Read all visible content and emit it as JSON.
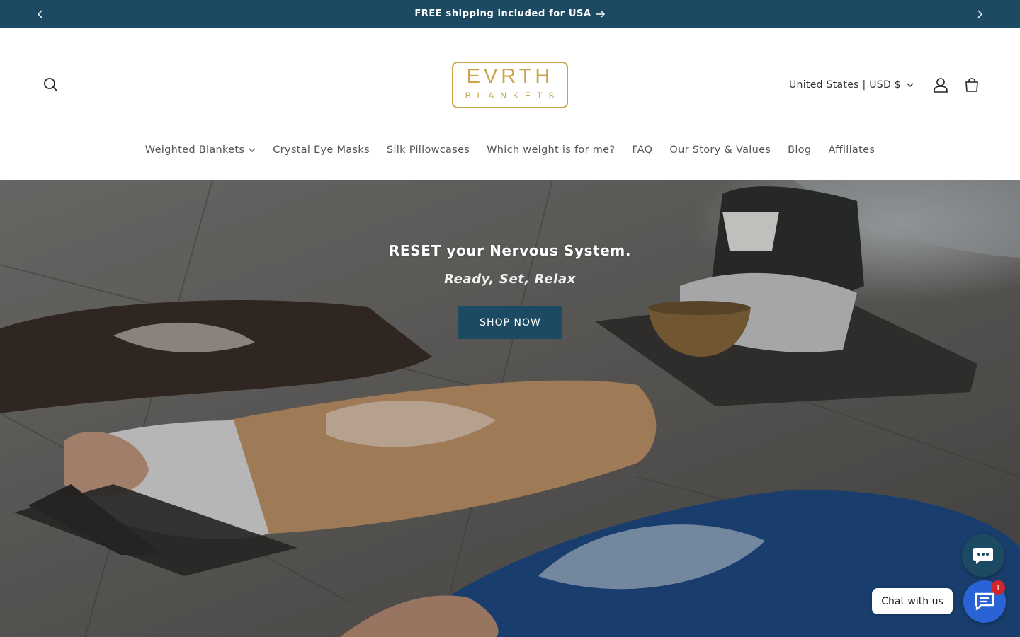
{
  "announcement": {
    "text": "FREE shipping included for USA",
    "prev_icon": "chevron-left-icon",
    "next_icon": "chevron-right-icon",
    "link_icon": "arrow-right-icon"
  },
  "header": {
    "logo": {
      "line1": "EVRTH",
      "line2": "BLANKETS",
      "color": "#c9a24a"
    },
    "locale": "United States | USD $",
    "icons": [
      "search-icon",
      "account-icon",
      "cart-icon"
    ]
  },
  "nav": {
    "items": [
      {
        "label": "Weighted Blankets",
        "has_dropdown": true
      },
      {
        "label": "Crystal Eye Masks"
      },
      {
        "label": "Silk Pillowcases"
      },
      {
        "label": "Which weight is for me?"
      },
      {
        "label": "FAQ"
      },
      {
        "label": "Our Story & Values"
      },
      {
        "label": "Blog"
      },
      {
        "label": "Affiliates"
      }
    ]
  },
  "hero": {
    "title": "RESET your Nervous System.",
    "subtitle": "Ready, Set, Relax",
    "cta": "SHOP NOW"
  },
  "chat": {
    "label": "Chat with us",
    "badge": "1"
  },
  "colors": {
    "brand": "#1c4a63",
    "chat_blue": "#2a63d6",
    "badge_red": "#d4232b"
  }
}
